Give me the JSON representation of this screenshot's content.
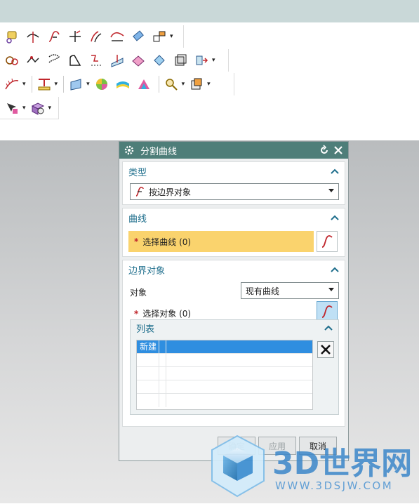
{
  "dialog": {
    "title": "分割曲线",
    "type_group": {
      "label": "类型",
      "selected": "按边界对象"
    },
    "curve_group": {
      "label": "曲线",
      "select_curve": "选择曲线 (0)"
    },
    "boundary_group": {
      "label": "边界对象",
      "object_label": "对象",
      "object_value": "现有曲线",
      "select_object": "选择对象 (0)",
      "list": {
        "label": "列表",
        "rows": [
          {
            "name": "新建"
          },
          {
            "name": ""
          },
          {
            "name": ""
          },
          {
            "name": ""
          },
          {
            "name": ""
          }
        ]
      }
    },
    "buttons": {
      "ok": "确定",
      "apply": "应用",
      "cancel": "取消"
    }
  },
  "watermark": {
    "brand": "3D世界网",
    "url": "WWW.3DSJW.COM"
  },
  "colors": {
    "dialog_header": "#4e7e79",
    "selection_highlight": "#fad36d",
    "group_title": "#1e6e8c",
    "list_selected": "#2f8ee0",
    "required_star": "#c0272d"
  },
  "icons": {
    "row1": [
      "edit-curve-icon",
      "trim-curve-icon",
      "split-curve-icon",
      "extend-curve-icon",
      "offset-curve-icon",
      "smooth-curve-icon",
      "eraser-icon",
      "resize-icon"
    ],
    "row2": [
      "bridge-curve-icon",
      "join-curve-icon",
      "fillet-icon",
      "boundary-icon",
      "projection-icon",
      "divide-face-icon",
      "surface-icon",
      "shape-icon",
      "frame-icon",
      "arrow-box-icon"
    ],
    "row3": [
      "comb-icon",
      "ruler-icon",
      "sheet-icon",
      "gradient-sphere-icon",
      "stripe-surface-icon",
      "rainbow-surface-icon",
      "magnifier-icon",
      "box-icon"
    ],
    "row4": [
      "arrow-palette-icon",
      "gear-cube-icon"
    ]
  }
}
